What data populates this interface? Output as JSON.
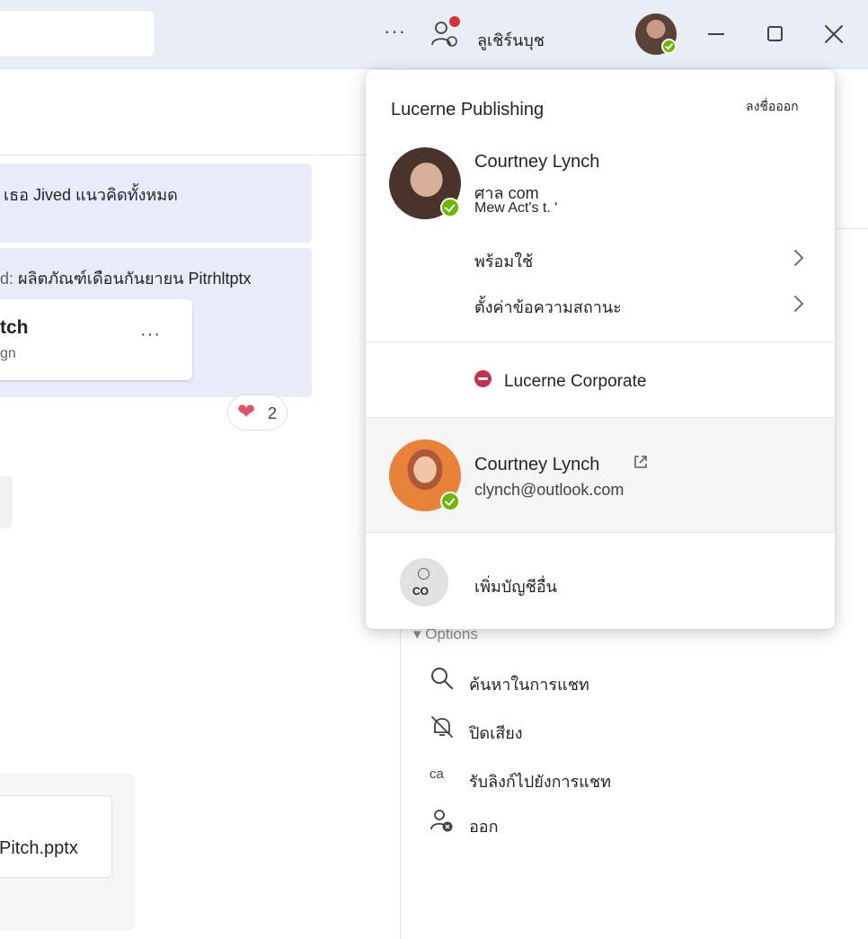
{
  "titlebar": {
    "more_label": "···",
    "username": "ลูเชิร์นบุช",
    "icons": [
      "more-icon",
      "people-icon",
      "minimize-icon",
      "maximize-icon",
      "close-icon"
    ],
    "notification_color": "#d13438"
  },
  "chat": {
    "message1": "เธอ Jived แนวคิดทั้งหมด",
    "message2_prefix": "d:",
    "message2": "ผลิตภัณฑ์เดือนกันยายน Pitrhltptx",
    "file_card_title": "tch",
    "file_card_sub": "gn",
    "file_card_more": "···",
    "reaction_icon": "heart-icon",
    "reaction_count": "2",
    "bottom_file_name": "Pitch.pptx"
  },
  "right_pane": {
    "options_label": "▾ Options",
    "items": [
      {
        "icon": "search-icon",
        "label": "ค้นหาในการแชท"
      },
      {
        "icon": "mute-icon",
        "label": "ปิดเสียง"
      },
      {
        "icon_text": "ca",
        "label": "รับลิงก์ไปยังการแชท"
      },
      {
        "icon": "leave-icon",
        "label": "ออก"
      }
    ]
  },
  "flyout": {
    "org_name": "Lucerne Publishing",
    "sign_out": "ลงชื่อออก",
    "work_account": {
      "name": "Courtney Lynch",
      "email": "ศาล com",
      "line3": "Mew Act's t. '"
    },
    "status_menu": "พร้อมใช้",
    "status_message_menu": "ตั้งค่าข้อความสถานะ",
    "corp_org": "Lucerne Corporate",
    "personal_account": {
      "name": "Courtney Lynch",
      "email": "clynch@outlook.com"
    },
    "add_account_initials": "CO",
    "add_account_label": "เพิ่มบัญชีอื่น",
    "colors": {
      "presence_available": "#6bb700",
      "do_not_disturb": "#c4314b",
      "chat_bubble": "#e8ebfa",
      "titlebar": "#e9edf5"
    }
  }
}
